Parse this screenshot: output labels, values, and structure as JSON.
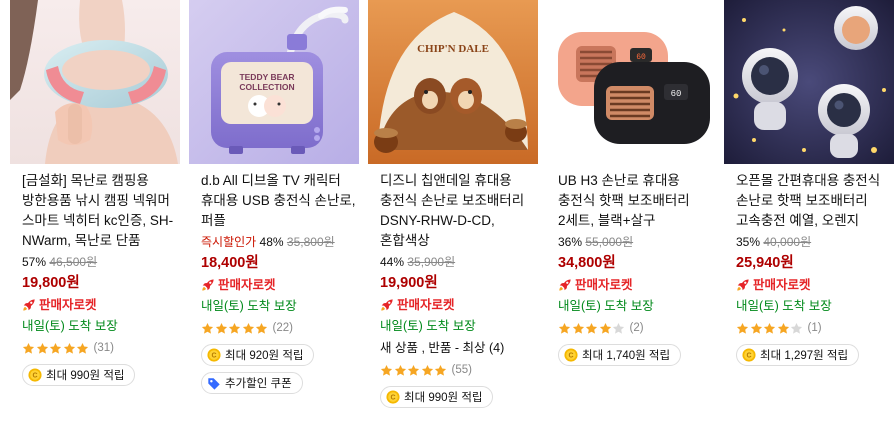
{
  "products": [
    {
      "title": "[금설화] 목난로 캠핑용 방한용품 낚시 캠핑 넥워머 스마트 넥히터 kc인증, SH-NWarm, 목난로 단품",
      "discount_rate": "57%",
      "original_price": "46,500원",
      "price": "19,800원",
      "rocket_label": "판매자로켓",
      "delivery": "내일(토) 도착 보장",
      "rating": 5,
      "review_count": "(31)",
      "points": "최대 990원 적립",
      "image_icon": "neck-warmer-photo"
    },
    {
      "title": "d.b All 디브올 TV 캐릭터 휴대용 USB 충전식 손난로, 퍼플",
      "instant_label": "즉시할인가",
      "discount_rate": "48%",
      "original_price": "35,800원",
      "price": "18,400원",
      "rocket_label": "판매자로켓",
      "delivery": "내일(토) 도착 보장",
      "rating": 5,
      "review_count": "(22)",
      "points": "최대 920원 적립",
      "coupon": "추가할인 쿠폰",
      "image_icon": "tv-hand-warmer-photo",
      "image_text": "TEDDY BEAR COLLECTION"
    },
    {
      "title": "디즈니 칩앤데일 휴대용 충전식 손난로 보조배터리 DSNY-RHW-D-CD, 혼합색상",
      "discount_rate": "44%",
      "original_price": "35,900원",
      "price": "19,900원",
      "rocket_label": "판매자로켓",
      "delivery": "내일(토) 도착 보장",
      "used_label": "새 상품 , 반품 - 최상 (4)",
      "rating": 5,
      "review_count": "(55)",
      "points": "최대 990원 적립",
      "image_icon": "chip-dale-warmer-photo",
      "image_text": "CHIP'N DALE"
    },
    {
      "title": "UB H3 손난로 휴대용 충전식 핫팩 보조배터리 2세트, 블랙+살구",
      "discount_rate": "36%",
      "original_price": "55,000원",
      "price": "34,800원",
      "rocket_label": "판매자로켓",
      "delivery": "내일(토) 도착 보장",
      "rating": 4,
      "review_count": "(2)",
      "points": "최대 1,740원 적립",
      "image_icon": "radio-warmer-photo",
      "image_text": "60"
    },
    {
      "title": "오픈몰 간편휴대용 충전식 손난로 핫팩 보조배터리 고속충전 예열, 오렌지",
      "discount_rate": "35%",
      "original_price": "40,000원",
      "price": "25,940원",
      "rocket_label": "판매자로켓",
      "delivery": "내일(토) 도착 보장",
      "rating": 4,
      "review_count": "(1)",
      "points": "최대 1,297원 적립",
      "image_icon": "astronaut-warmer-photo"
    }
  ],
  "colors": {
    "price": "#ae0000",
    "rocket": "#e52528",
    "delivery": "#00891a",
    "star": "#f6a623",
    "instant": "#cb1400",
    "coin": "#f5b800"
  }
}
